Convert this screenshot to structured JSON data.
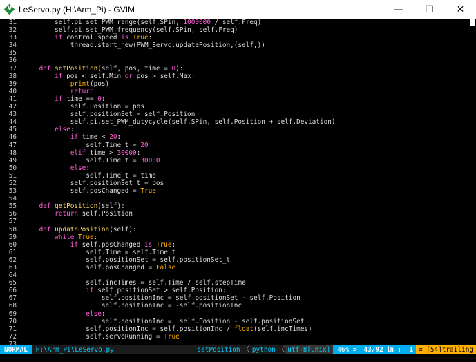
{
  "window": {
    "title": "LeServo.py (H:\\Arm_Pi) - GVIM",
    "minimize": "—",
    "maximize": "☐",
    "close": "✕",
    "app_icon_letter": "V"
  },
  "lines": [
    {
      "n": "31",
      "t": [
        [
          "        self.pi.set_PWM_range(self.SPin, ",
          ""
        ],
        [
          "1000000",
          "num"
        ],
        [
          " / self.Freq)",
          ""
        ]
      ]
    },
    {
      "n": "32",
      "t": [
        [
          "        self.pi.set_PWM_frequency(self.SPin, self.Freq)",
          ""
        ]
      ]
    },
    {
      "n": "33",
      "t": [
        [
          "        ",
          ""
        ],
        [
          "if",
          "kw"
        ],
        [
          " control_speed ",
          ""
        ],
        [
          "is",
          "kw"
        ],
        [
          " ",
          ""
        ],
        [
          "True",
          "const"
        ],
        [
          ":",
          ""
        ]
      ]
    },
    {
      "n": "34",
      "t": [
        [
          "            thread.start_new(PWM_Servo.updatePosition,(self,))",
          ""
        ]
      ]
    },
    {
      "n": "35",
      "t": []
    },
    {
      "n": "36",
      "t": []
    },
    {
      "n": "37",
      "t": [
        [
          "    ",
          ""
        ],
        [
          "def",
          "kw"
        ],
        [
          " ",
          ""
        ],
        [
          "setPosition",
          "fn"
        ],
        [
          "(self, pos, time = ",
          ""
        ],
        [
          "0",
          "num"
        ],
        [
          "):",
          ""
        ]
      ]
    },
    {
      "n": "38",
      "t": [
        [
          "        ",
          ""
        ],
        [
          "if",
          "kw"
        ],
        [
          " pos < self.Min ",
          ""
        ],
        [
          "or",
          "kw"
        ],
        [
          " pos > self.Max:",
          ""
        ]
      ]
    },
    {
      "n": "39",
      "t": [
        [
          "            ",
          ""
        ],
        [
          "print",
          "pr"
        ],
        [
          "(pos)",
          ""
        ]
      ]
    },
    {
      "n": "40",
      "t": [
        [
          "            ",
          ""
        ],
        [
          "return",
          "kw"
        ]
      ]
    },
    {
      "n": "41",
      "t": [
        [
          "        ",
          ""
        ],
        [
          "if",
          "kw"
        ],
        [
          " time == ",
          ""
        ],
        [
          "0",
          "num"
        ],
        [
          ":",
          ""
        ]
      ]
    },
    {
      "n": "42",
      "t": [
        [
          "            self.Position = pos",
          ""
        ]
      ]
    },
    {
      "n": "43",
      "t": [
        [
          "            self.positionSet = self.Position",
          ""
        ]
      ]
    },
    {
      "n": "44",
      "t": [
        [
          "            self.pi.set_PWM_dutycycle(self.SPin, self.Position + self.Deviation)",
          ""
        ]
      ]
    },
    {
      "n": "45",
      "t": [
        [
          "        ",
          ""
        ],
        [
          "else",
          "kw"
        ],
        [
          ":",
          ""
        ]
      ]
    },
    {
      "n": "46",
      "t": [
        [
          "            ",
          ""
        ],
        [
          "if",
          "kw"
        ],
        [
          " time < ",
          ""
        ],
        [
          "20",
          "num"
        ],
        [
          ":",
          ""
        ]
      ]
    },
    {
      "n": "47",
      "t": [
        [
          "                self.Time_t = ",
          ""
        ],
        [
          "20",
          "num"
        ]
      ]
    },
    {
      "n": "48",
      "t": [
        [
          "            ",
          ""
        ],
        [
          "elif",
          "kw"
        ],
        [
          " time > ",
          ""
        ],
        [
          "30000",
          "num"
        ],
        [
          ":",
          ""
        ]
      ]
    },
    {
      "n": "49",
      "t": [
        [
          "                self.Time_t = ",
          ""
        ],
        [
          "30000",
          "num"
        ]
      ]
    },
    {
      "n": "50",
      "t": [
        [
          "            ",
          ""
        ],
        [
          "else",
          "kw"
        ],
        [
          ":",
          ""
        ]
      ]
    },
    {
      "n": "51",
      "t": [
        [
          "                self.Time_t = time",
          ""
        ]
      ]
    },
    {
      "n": "52",
      "t": [
        [
          "            self.positionSet_t = pos",
          ""
        ]
      ]
    },
    {
      "n": "53",
      "t": [
        [
          "            self.posChanged = ",
          ""
        ],
        [
          "True",
          "const"
        ]
      ]
    },
    {
      "n": "54",
      "t": []
    },
    {
      "n": "55",
      "t": [
        [
          "    ",
          ""
        ],
        [
          "def",
          "kw"
        ],
        [
          " ",
          ""
        ],
        [
          "getPosition",
          "fn"
        ],
        [
          "(self):",
          ""
        ]
      ]
    },
    {
      "n": "56",
      "t": [
        [
          "        ",
          ""
        ],
        [
          "return",
          "kw"
        ],
        [
          " self.Position",
          ""
        ]
      ]
    },
    {
      "n": "57",
      "t": []
    },
    {
      "n": "58",
      "t": [
        [
          "    ",
          ""
        ],
        [
          "def",
          "kw"
        ],
        [
          " ",
          ""
        ],
        [
          "updatePosition",
          "fn"
        ],
        [
          "(self):",
          ""
        ]
      ]
    },
    {
      "n": "59",
      "t": [
        [
          "        ",
          ""
        ],
        [
          "while",
          "kw"
        ],
        [
          " ",
          ""
        ],
        [
          "True",
          "const"
        ],
        [
          ":",
          ""
        ]
      ]
    },
    {
      "n": "60",
      "t": [
        [
          "            ",
          ""
        ],
        [
          "if",
          "kw"
        ],
        [
          " self.posChanged ",
          ""
        ],
        [
          "is",
          "kw"
        ],
        [
          " ",
          ""
        ],
        [
          "True",
          "const"
        ],
        [
          ":",
          ""
        ]
      ]
    },
    {
      "n": "61",
      "t": [
        [
          "                self.Time = self.Time_t",
          ""
        ]
      ]
    },
    {
      "n": "62",
      "t": [
        [
          "                self.positionSet = self.positionSet_t",
          ""
        ]
      ]
    },
    {
      "n": "63",
      "t": [
        [
          "                self.posChanged = ",
          ""
        ],
        [
          "False",
          "const"
        ]
      ]
    },
    {
      "n": "64",
      "t": []
    },
    {
      "n": "65",
      "t": [
        [
          "                self.incTimes = self.Time / self.stepTime",
          ""
        ]
      ]
    },
    {
      "n": "66",
      "t": [
        [
          "                ",
          ""
        ],
        [
          "if",
          "kw"
        ],
        [
          " self.positionSet > self.Position:",
          ""
        ]
      ]
    },
    {
      "n": "67",
      "t": [
        [
          "                    self.positionInc = self.positionSet - self.Position",
          ""
        ]
      ]
    },
    {
      "n": "68",
      "t": [
        [
          "                    self.positionInc = -self.positionInc",
          ""
        ]
      ]
    },
    {
      "n": "69",
      "t": [
        [
          "                ",
          ""
        ],
        [
          "else",
          "kw"
        ],
        [
          ":",
          ""
        ]
      ]
    },
    {
      "n": "70",
      "t": [
        [
          "                    self.positionInc =  self.Position - self.positionSet",
          ""
        ]
      ]
    },
    {
      "n": "71",
      "t": [
        [
          "                self.positionInc = self.positionInc / ",
          ""
        ],
        [
          "float",
          "pr"
        ],
        [
          "(self.incTimes)",
          ""
        ]
      ]
    },
    {
      "n": "72",
      "t": [
        [
          "                self.servoRunning = ",
          ""
        ],
        [
          "True",
          "const"
        ]
      ]
    },
    {
      "n": "73",
      "t": []
    }
  ],
  "status": {
    "mode": "NORMAL",
    "file": "H:\\Arm_Pi\\LeServo.py",
    "function": "setPosition",
    "sep1": "〈",
    "filetype": "python",
    "sep2": "〈",
    "encoding": "utf-8[unix]",
    "percent": "46% ≡",
    "position": "43/92 ㏑ :  1",
    "trailing": "≡ [54]trailing"
  }
}
